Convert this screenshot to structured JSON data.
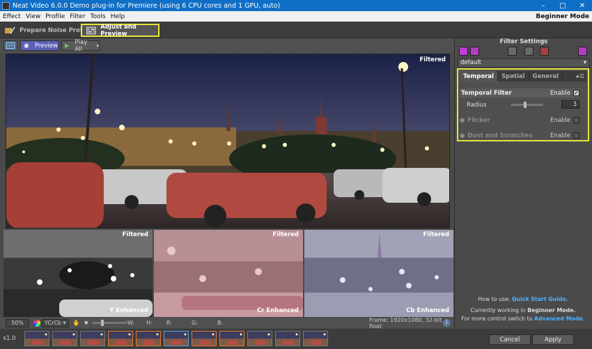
{
  "window": {
    "title": "Neat Video 6.0.0 Demo plug-in for Premiere (using 6 CPU cores and 1 GPU, auto)",
    "controls": [
      "–",
      "□",
      "✕"
    ]
  },
  "menu": {
    "items": [
      "Effect",
      "View",
      "Profile",
      "Filter",
      "Tools",
      "Help"
    ],
    "mode": "Beginner Mode"
  },
  "stage_tabs": {
    "prepare": "Prepare Noise Profile",
    "adjust": "Adjust and Preview"
  },
  "toolbar": {
    "preview": "Preview",
    "play_all": "Play All"
  },
  "viewer": {
    "main_label": "Filtered",
    "panels": [
      {
        "top": "Filtered",
        "bottom": "Y Enhanced"
      },
      {
        "top": "Filtered",
        "bottom": "Cr Enhanced"
      },
      {
        "top": "Filtered",
        "bottom": "Cb Enhanced"
      }
    ]
  },
  "status": {
    "zoom": "50%",
    "color_space": "YCrCb",
    "w_label": "W:",
    "h_label": "H:",
    "r_label": "R:",
    "g_label": "G:",
    "b_label": "B:",
    "frame": "Frame: 1920x1080, 32-bit float"
  },
  "timeline": {
    "speed": "x1.0",
    "thumb_count": 11
  },
  "buttons": {
    "cancel": "Cancel",
    "apply": "Apply"
  },
  "filter_settings": {
    "title": "Filter Settings",
    "preset": "default",
    "tabs": [
      "Temporal",
      "Spatial",
      "General"
    ],
    "temporal_filter": {
      "label": "Temporal Filter",
      "enable": "Enable",
      "checked": true
    },
    "radius": {
      "label": "Radius",
      "value": "3"
    },
    "flicker": {
      "label": "Flicker",
      "enable": "Enable",
      "checked": false
    },
    "dust": {
      "label": "Dust and Scratches",
      "enable": "Enable",
      "checked": false
    }
  },
  "help": {
    "how_to": "How to use:",
    "quick_start": "Quick Start Guide.",
    "working_in": "Currently working in",
    "working_mode": "Beginner Mode.",
    "more_control": "For more control switch to",
    "advanced": "Advanced Mode."
  }
}
